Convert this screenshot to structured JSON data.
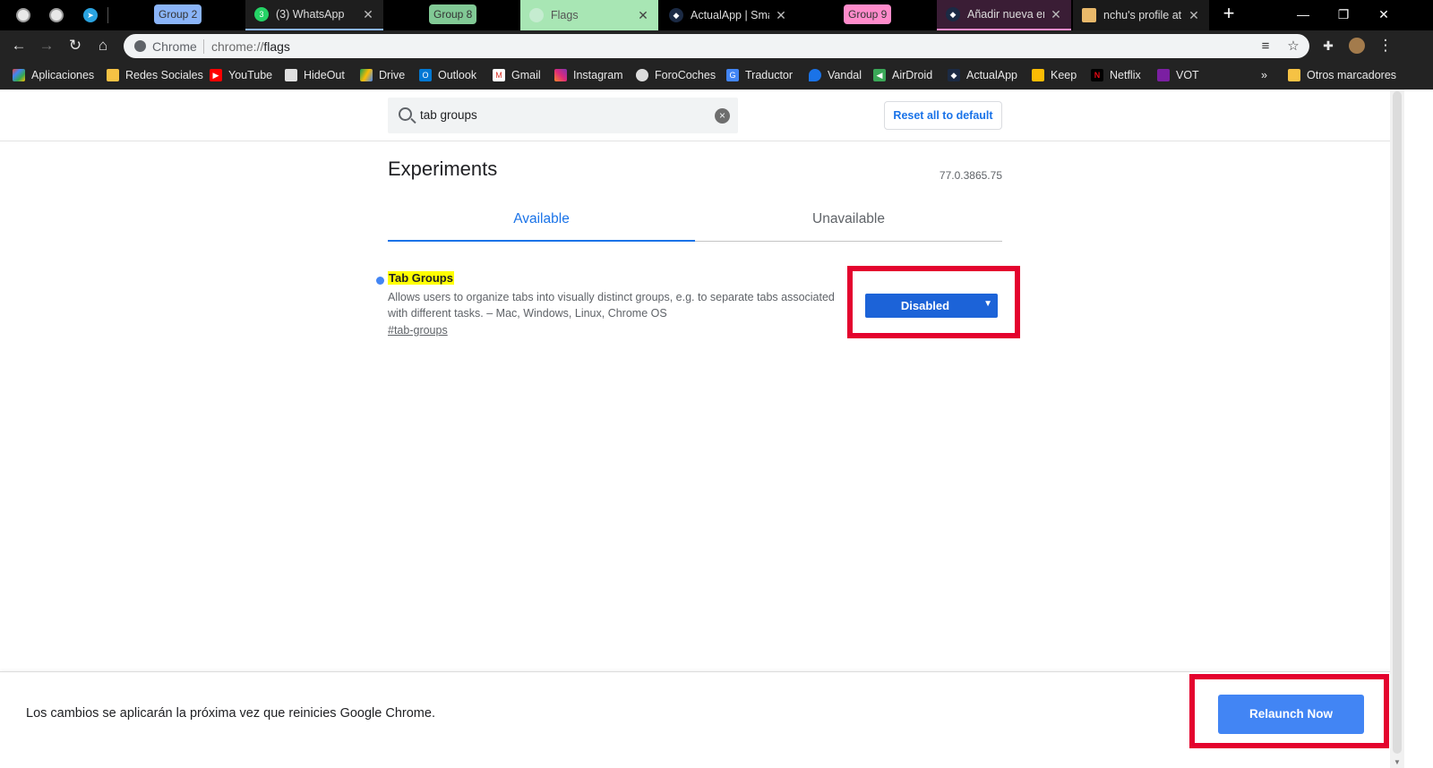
{
  "tabstrip": {
    "groups": [
      "Group 2",
      "Group 8",
      "Group 9"
    ],
    "group_colors": {
      "group2": "#8ab4f8",
      "group8": "#81c995",
      "group9": "#ff8bcb"
    },
    "tabs": [
      {
        "title": "(3) WhatsApp",
        "badge": "3"
      },
      {
        "title": "Flags"
      },
      {
        "title": "ActualApp | Smar"
      },
      {
        "title": "Añadir nueva ent"
      },
      {
        "title": "nchu's profile at"
      }
    ],
    "new_tab": "+",
    "window": {
      "minimize": "—",
      "restore": "❐",
      "close": "✕"
    }
  },
  "toolbar": {
    "back": "←",
    "forward": "→",
    "reload": "↻",
    "home": "⌂",
    "omnibox": {
      "site": "Chrome",
      "scheme": "chrome://",
      "path": "flags"
    }
  },
  "bookmarks": [
    {
      "label": "Aplicaciones",
      "icon": "apps-grid-icon"
    },
    {
      "label": "Redes Sociales",
      "icon": "folder-icon"
    },
    {
      "label": "YouTube",
      "icon": "youtube-icon"
    },
    {
      "label": "HideOut",
      "icon": "hideout-icon"
    },
    {
      "label": "Drive",
      "icon": "drive-icon"
    },
    {
      "label": "Outlook",
      "icon": "outlook-icon"
    },
    {
      "label": "Gmail",
      "icon": "gmail-icon"
    },
    {
      "label": "Instagram",
      "icon": "instagram-icon"
    },
    {
      "label": "ForoCoches",
      "icon": "forocoches-icon"
    },
    {
      "label": "Traductor",
      "icon": "translate-icon"
    },
    {
      "label": "Vandal",
      "icon": "vandal-icon"
    },
    {
      "label": "AirDroid",
      "icon": "airdroid-icon"
    },
    {
      "label": "ActualApp",
      "icon": "actualapp-icon"
    },
    {
      "label": "Keep",
      "icon": "keep-icon"
    },
    {
      "label": "Netflix",
      "icon": "netflix-icon"
    },
    {
      "label": "VOT",
      "icon": "vot-icon"
    },
    {
      "label": "Otros marcadores",
      "icon": "folder-icon"
    }
  ],
  "bookmarks_overflow": "»",
  "flags_page": {
    "search": {
      "value": "tab groups"
    },
    "reset_label": "Reset all to default",
    "title": "Experiments",
    "version": "77.0.3865.75",
    "tabs": {
      "available": "Available",
      "unavailable": "Unavailable"
    },
    "flag": {
      "name": "Tab Groups",
      "description_line1": "Allows users to organize tabs into visually distinct groups, e.g. to separate tabs associated",
      "description_line2": "with different tasks. – Mac, Windows, Linux, Chrome OS",
      "link": "#tab-groups",
      "selected_value": "Disabled"
    },
    "footer_message": "Los cambios se aplicarán la próxima vez que reinicies Google Chrome.",
    "relaunch_label": "Relaunch Now"
  },
  "colors": {
    "accent": "#1a73e8",
    "highlight_box": "#e4032e",
    "relaunch_bg": "#4285f4"
  }
}
